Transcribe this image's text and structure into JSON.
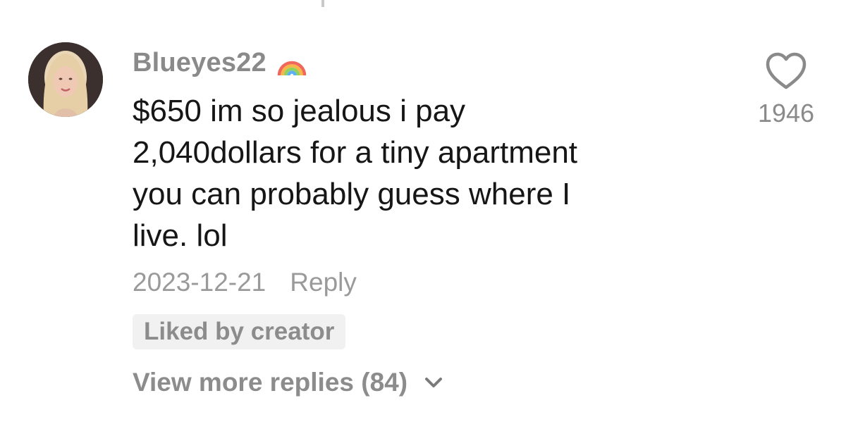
{
  "comment": {
    "username": "Blueyes22",
    "username_badge_icon": "rainbow-icon",
    "text_lines": [
      "$650 im so jealous i pay",
      "2,040dollars for a tiny apartment",
      "you can probably guess where I",
      "live. lol"
    ],
    "date": "2023-12-21",
    "reply_label": "Reply",
    "liked_by_creator_label": "Liked by creator",
    "like_icon": "heart-outline-icon",
    "like_count": "1946",
    "view_more_replies_label": "View more replies (84)",
    "view_more_icon": "chevron-down-icon"
  },
  "colors": {
    "username": "#8a8a8a",
    "body_text": "#161616",
    "meta_text": "#9a9a9a",
    "badge_background": "#f1f1f2"
  }
}
